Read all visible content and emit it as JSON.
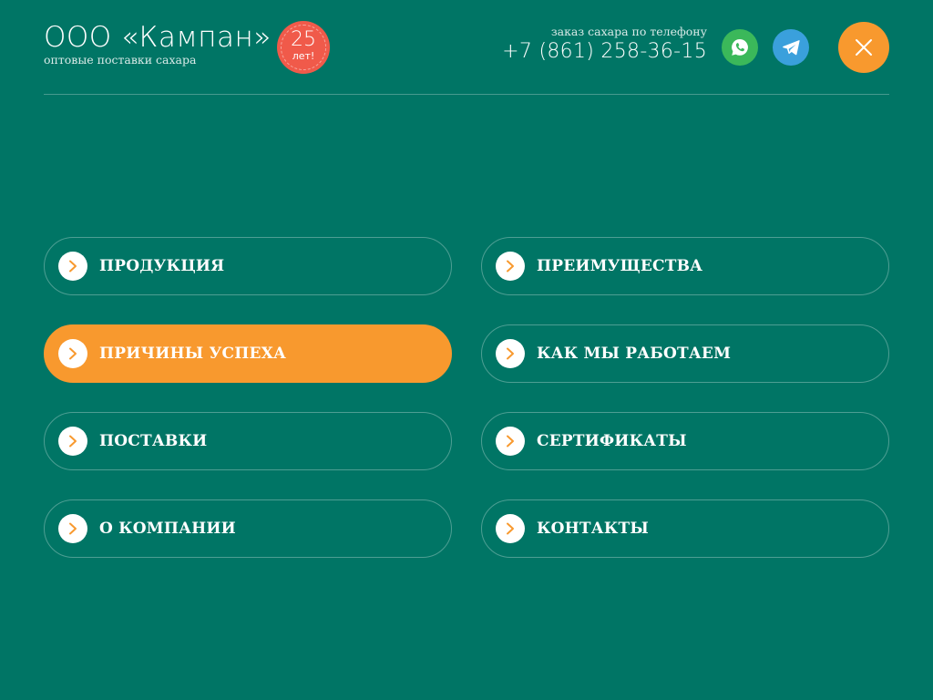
{
  "header": {
    "logo": {
      "name": "ООО «Кампан»",
      "tagline": "оптовые поставки сахара"
    },
    "badge": {
      "number": "25",
      "unit": "лет!"
    },
    "contact": {
      "label": "заказ сахара по телефону",
      "phone": "+7 (861) 258-36-15"
    },
    "social": [
      {
        "name": "whatsapp-icon"
      },
      {
        "name": "telegram-icon"
      }
    ],
    "close_icon": "close-icon"
  },
  "menu": {
    "items": [
      {
        "label": "ПРОДУКЦИЯ",
        "active": false
      },
      {
        "label": "ПРЕИМУЩЕСТВА",
        "active": false
      },
      {
        "label": "ПРИЧИНЫ УСПЕХА",
        "active": true
      },
      {
        "label": "КАК МЫ РАБОТАЕМ",
        "active": false
      },
      {
        "label": "ПОСТАВКИ",
        "active": false
      },
      {
        "label": "СЕРТИФИКАТЫ",
        "active": false
      },
      {
        "label": "О КОМПАНИИ",
        "active": false
      },
      {
        "label": "КОНТАКТЫ",
        "active": false
      }
    ]
  },
  "colors": {
    "background": "#007565",
    "accent": "#f8992e",
    "badge": "#f05a4a",
    "whatsapp": "#3bb85a",
    "telegram": "#3aa0dc",
    "text": "#ffffff"
  }
}
